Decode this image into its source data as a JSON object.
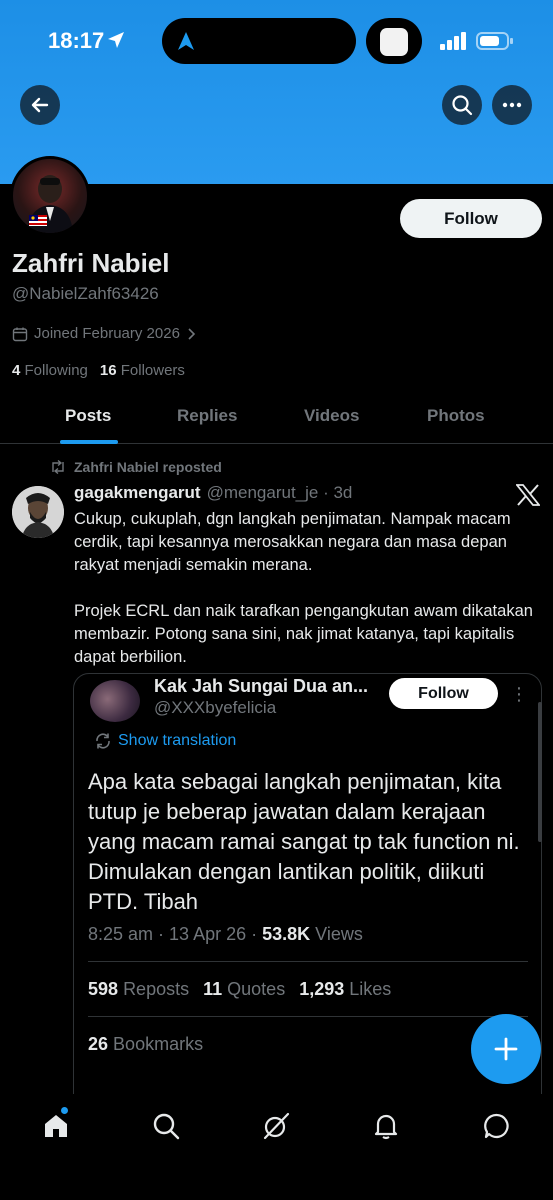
{
  "status_bar": {
    "time": "18:17"
  },
  "profile": {
    "name": "Zahfri Nabiel",
    "handle": "@NabielZahf63426",
    "joined": "Joined February 2026",
    "following_count": "4",
    "following_label": "Following",
    "followers_count": "16",
    "followers_label": "Followers",
    "follow_label": "Follow"
  },
  "tabs": [
    {
      "label": "Posts"
    },
    {
      "label": "Replies"
    },
    {
      "label": "Videos"
    },
    {
      "label": "Photos"
    }
  ],
  "post": {
    "repost_label": "Zahfri Nabiel reposted",
    "author": "gagakmengarut",
    "meta": "@mengarut_je · 3d",
    "text": "Cukup, cukuplah, dgn langkah penjimatan. Nampak macam cerdik, tapi kesannya merosakkan negara dan masa depan rakyat menjadi semakin merana.\n\nProjek ECRL dan naik tarafkan pengangkutan awam dikatakan membazir. Potong sana sini, nak jimat katanya, tapi kapitalis dapat berbilion."
  },
  "quote": {
    "name": "Kak Jah Sungai Dua an...",
    "handle": "@XXXbyefelicia",
    "follow_label": "Follow",
    "translate_label": "Show translation",
    "text": "Apa kata sebagai langkah penjimatan, kita tutup je beberap jawatan dalam kerajaan yang macam ramai sangat tp tak function ni. Dimulakan dengan lantikan politik, diikuti PTD. Tibah",
    "time": "8:25 am · 13 Apr 26 · ",
    "views_count": "53.8K",
    "views_label": " Views",
    "reposts_count": "598",
    "reposts_label": "Reposts",
    "quotes_count": "11",
    "quotes_label": "Quotes",
    "likes_count": "1,293",
    "likes_label": "Likes",
    "bookmarks_count": "26",
    "bookmarks_label": "Bookmarks"
  },
  "colors": {
    "accent": "#1d9bf0",
    "banner": "#1d8fe6",
    "background": "#000000"
  },
  "icons": [
    "back-arrow-icon",
    "search-icon",
    "more-icon",
    "calendar-icon",
    "chevron-right-icon",
    "repost-icon",
    "x-logo-icon",
    "translate-icon",
    "compose-plus-icon",
    "home-icon",
    "grok-icon",
    "bell-icon",
    "messages-icon"
  ]
}
